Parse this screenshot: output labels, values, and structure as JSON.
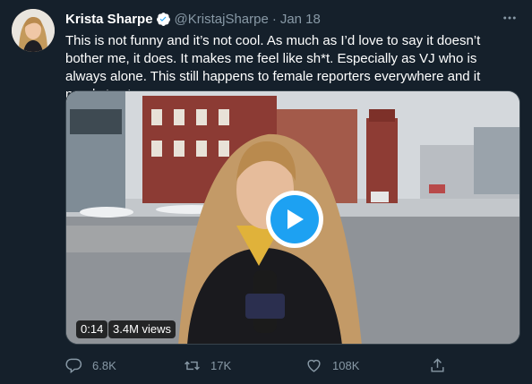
{
  "tweet": {
    "author_name": "Krista Sharpe",
    "handle": "@KristajSharpe",
    "separator": "·",
    "date": "Jan 18",
    "text": "This is not funny and it’s not cool. As much as I’d love to say it doesn’t bother me, it does. It makes me feel like sh*t. Especially as VJ who is always alone. This still happens to female reporters everywhere and it needs to stop.",
    "verified_icon": "verified-badge-icon",
    "more_icon": "more-options-icon"
  },
  "video": {
    "duration": "0:14",
    "views": "3.4M views",
    "play_icon": "play-icon",
    "microphone_logo": "CTV"
  },
  "actions": {
    "replies": "6.8K",
    "retweets": "17K",
    "likes": "108K",
    "share_icon": "share-icon"
  },
  "colors": {
    "background": "#15202b",
    "accent": "#1da1f2",
    "secondary_text": "#8899a6"
  }
}
